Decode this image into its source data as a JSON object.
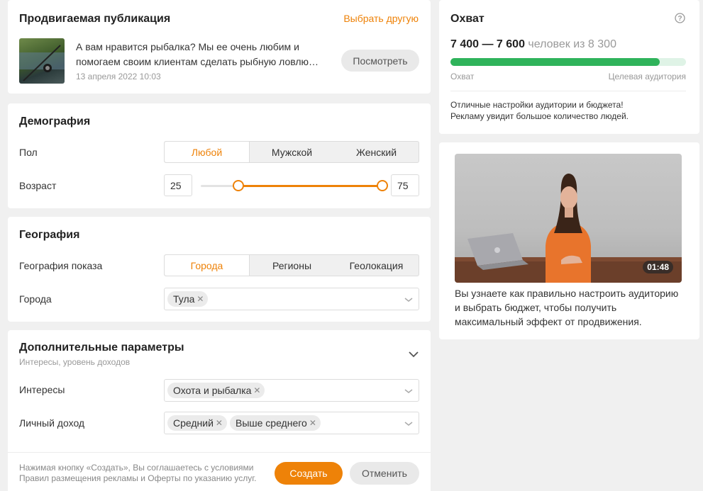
{
  "publication": {
    "title": "Продвигаемая публикация",
    "choose_other": "Выбрать другую",
    "text_line1": "А вам нравится рыбалка? Мы ее очень любим и",
    "text_line2": "помогаем своим клиентам сделать рыбную ловлю…",
    "date": "13 апреля 2022 10:03",
    "view_button": "Посмотреть"
  },
  "demography": {
    "title": "Демография",
    "gender_label": "Пол",
    "gender_options": [
      "Любой",
      "Мужской",
      "Женский"
    ],
    "gender_selected": "Любой",
    "age_label": "Возраст",
    "age_min": "25",
    "age_max": "75"
  },
  "geography": {
    "title": "География",
    "show_label": "География показа",
    "show_options": [
      "Города",
      "Регионы",
      "Геолокация"
    ],
    "show_selected": "Города",
    "cities_label": "Города",
    "cities": [
      "Тула"
    ]
  },
  "extra": {
    "title": "Дополнительные параметры",
    "subtitle": "Интересы, уровень доходов",
    "interests_label": "Интересы",
    "interests": [
      "Охота и рыбалка"
    ],
    "income_label": "Личный доход",
    "income": [
      "Средний",
      "Выше среднего"
    ]
  },
  "footer": {
    "terms_line1": "Нажимая кнопку «Создать», Вы соглашаетесь с условиями",
    "terms_line2": "Правил размещения рекламы и Оферты по указанию услуг.",
    "create_button": "Создать",
    "cancel_button": "Отменить"
  },
  "reach": {
    "title": "Охват",
    "range": "7 400 — 7 600",
    "of_text": "человек из 8 300",
    "progress_fraction": 0.89,
    "label_left": "Охват",
    "label_right": "Целевая аудитория",
    "note_line1": "Отличные настройки аудитории и бюджета!",
    "note_line2": "Рекламу увидит большое количество людей."
  },
  "video": {
    "duration": "01:48",
    "desc_line1": "Вы узнаете как правильно настроить аудиторию",
    "desc_line2": "и выбрать бюджет, чтобы получить",
    "desc_line3": "максимальный эффект от продвижения."
  },
  "colors": {
    "accent": "#ee8208",
    "progress": "#2fb35b",
    "progress_track": "#dff3e6"
  }
}
